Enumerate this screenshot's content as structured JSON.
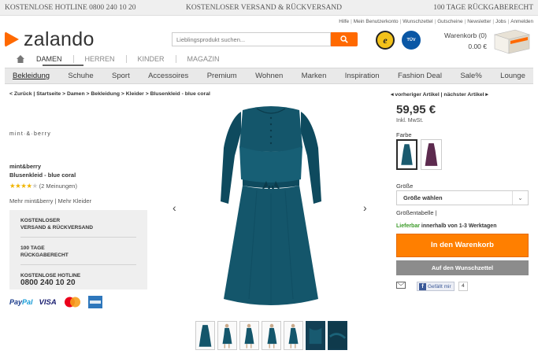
{
  "topbar": {
    "hotline": "KOSTENLOSE HOTLINE 0800 240 10 20",
    "shipping": "KOSTENLOSER VERSAND & RÜCKVERSAND",
    "returns": "100 TAGE RÜCKGABERECHT"
  },
  "toplinks": [
    "Hilfe",
    "Mein Benutzerkonto",
    "Wunschzettel",
    "Gutscheine",
    "Newsletter",
    "Jobs",
    "Anmelden"
  ],
  "logo": {
    "text": "zalando"
  },
  "search": {
    "placeholder": "Lieblingsprodukt suchen..."
  },
  "cart": {
    "title": "Warenkorb (0)",
    "value": "0.00 €"
  },
  "catnav": {
    "items": [
      "DAMEN",
      "HERREN",
      "KINDER",
      "MAGAZIN"
    ],
    "active": "DAMEN"
  },
  "mainnav": {
    "items": [
      "Bekleidung",
      "Schuhe",
      "Sport",
      "Accessoires",
      "Premium",
      "Wohnen",
      "Marken",
      "Inspiration",
      "Fashion Deal",
      "Sale%",
      "Lounge"
    ],
    "active": "Bekleidung"
  },
  "breadcrumb": {
    "back": "< Zurück",
    "items": [
      "Startseite",
      "Damen",
      "Bekleidung",
      "Kleider",
      "Blusenkleid - blue coral"
    ]
  },
  "article_nav": {
    "prev": "vorheriger Artikel",
    "next": "nächster Artikel"
  },
  "product": {
    "brand_logo": "mint·&·berry",
    "brand": "mint&berry",
    "name": "Blusenkleid - blue coral",
    "rating": 4,
    "rating_max": 5,
    "reviews": "(2 Meinungen)",
    "more": "Mehr mint&berry | Mehr Kleider",
    "price": "59,95 €",
    "vat": "Inkl. MwSt.",
    "color_label": "Farbe",
    "size_label": "Größe",
    "size_select": "Größe wählen",
    "size_table": "Größentabelle |",
    "availability_status": "Lieferbar",
    "availability_text": " innerhalb von 1-3 Werktagen",
    "add_to_cart": "In den Warenkorb",
    "wishlist": "Auf den Wunschzettel",
    "fb_like": "Gefällt mir",
    "fb_count": "4",
    "colors": [
      "#1a5a6e",
      "#5c2a4e"
    ]
  },
  "infobox": [
    {
      "line1": "KOSTENLOSER",
      "line2": "VERSAND & RÜCKVERSAND"
    },
    {
      "line1": "100 TAGE",
      "line2": "RÜCKGABERECHT"
    },
    {
      "line1": "KOSTENLOSE HOTLINE",
      "line2": "0800 240 10 20"
    }
  ],
  "payments": {
    "paypal_a": "Pay",
    "paypal_b": "Pal",
    "visa": "VISA"
  },
  "colors": {
    "accent": "#ff6900",
    "cta": "#ff7f00",
    "dress": "#14566b",
    "dress_dark": "#0e4152"
  }
}
